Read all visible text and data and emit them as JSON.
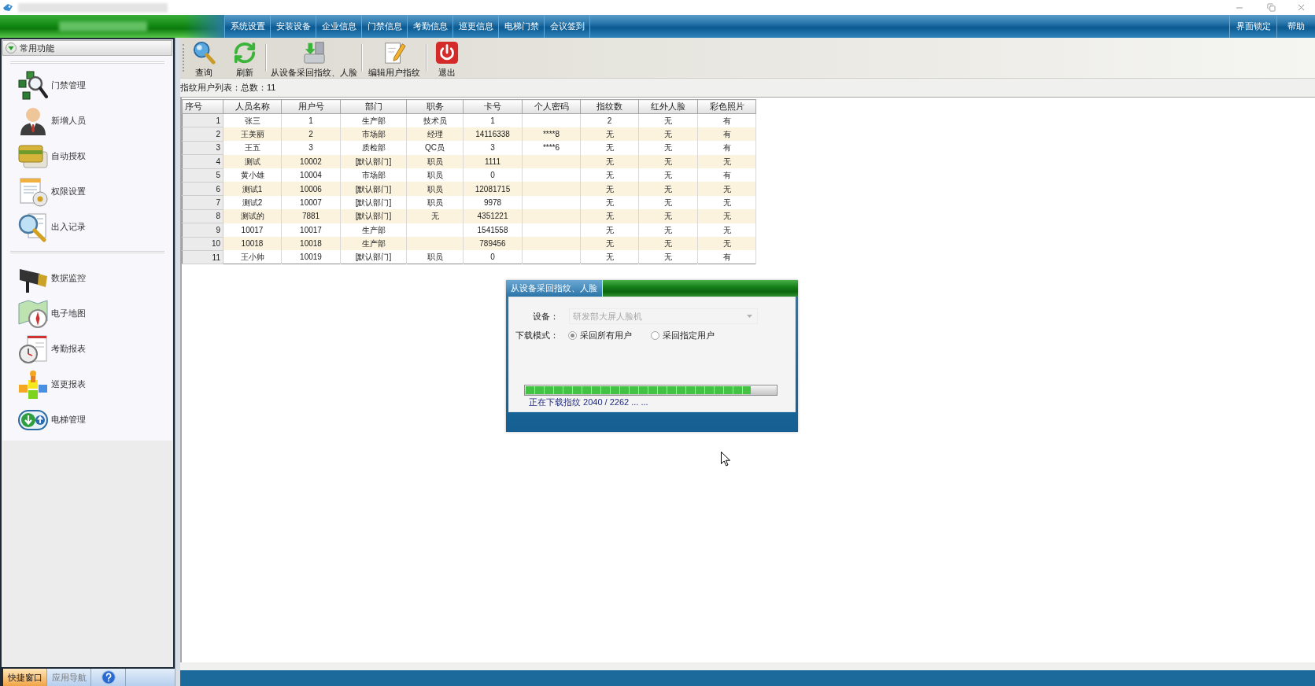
{
  "menu": {
    "items": [
      "系统设置",
      "安装设备",
      "企业信息",
      "门禁信息",
      "考勤信息",
      "巡更信息",
      "电梯门禁",
      "会议签到"
    ],
    "right_items": [
      "界面锁定",
      "帮助"
    ]
  },
  "sidebar": {
    "header": "常用功能",
    "groups": [
      [
        "门禁管理",
        "新增人员",
        "自动授权",
        "权限设置",
        "出入记录"
      ],
      [
        "数据监控",
        "电子地图",
        "考勤报表",
        "巡更报表",
        "电梯管理"
      ]
    ],
    "tabs": [
      {
        "label": "快捷窗口",
        "selected": true
      },
      {
        "label": "应用导航",
        "selected": false
      }
    ]
  },
  "toolbar": {
    "buttons": [
      "查询",
      "刷新",
      "从设备采回指纹、人脸",
      "编辑用户指纹",
      "退出"
    ]
  },
  "list_caption": "指纹用户列表：总数：11",
  "table": {
    "columns": [
      "序号",
      "人员名称",
      "用户号",
      "部门",
      "职务",
      "卡号",
      "个人密码",
      "指纹数",
      "红外人脸",
      "彩色照片"
    ],
    "rows": [
      [
        "1",
        "张三",
        "1",
        "生产部",
        "技术员",
        "1",
        null,
        "2",
        "无",
        "有"
      ],
      [
        "2",
        "王美丽",
        "2",
        "市场部",
        "经理",
        "14116338",
        "****8",
        "无",
        "无",
        "有"
      ],
      [
        "3",
        "王五",
        "3",
        "质检部",
        "QC员",
        "3",
        "****6",
        "无",
        "无",
        "有"
      ],
      [
        "4",
        "测试",
        "10002",
        "[默认部门]",
        "职员",
        "1111",
        null,
        "无",
        "无",
        "无"
      ],
      [
        "5",
        "黄小雄",
        "10004",
        "市场部",
        "职员",
        "0",
        null,
        "无",
        "无",
        "有"
      ],
      [
        "6",
        "测试1",
        "10006",
        "[默认部门]",
        "职员",
        "12081715",
        null,
        "无",
        "无",
        "无"
      ],
      [
        "7",
        "测试2",
        "10007",
        "[默认部门]",
        "职员",
        "9978",
        null,
        "无",
        "无",
        "无"
      ],
      [
        "8",
        "测试的",
        "7881",
        "[默认部门]",
        "无",
        "4351221",
        null,
        "无",
        "无",
        "无"
      ],
      [
        "9",
        "10017",
        "10017",
        "生产部",
        null,
        "1541558",
        null,
        "无",
        "无",
        "无"
      ],
      [
        "10",
        "10018",
        "10018",
        "生产部",
        null,
        "789456",
        null,
        "无",
        "无",
        "无"
      ],
      [
        "11",
        "王小帅",
        "10019",
        "[默认部门]",
        "职员",
        "0",
        null,
        "无",
        "无",
        "有"
      ]
    ]
  },
  "dialog": {
    "title": "从设备采回指纹、人脸",
    "device": {
      "label": "设备：",
      "value": "研发部大屏人脸机",
      "disabled": true
    },
    "mode": {
      "label": "下载模式：",
      "options": [
        {
          "label": "采回所有用户",
          "selected": true
        },
        {
          "label": "采回指定用户",
          "selected": false
        }
      ]
    },
    "progress": {
      "level": 0.9,
      "status": "正在下载指纹 2040 / 2262 ... ..."
    }
  }
}
